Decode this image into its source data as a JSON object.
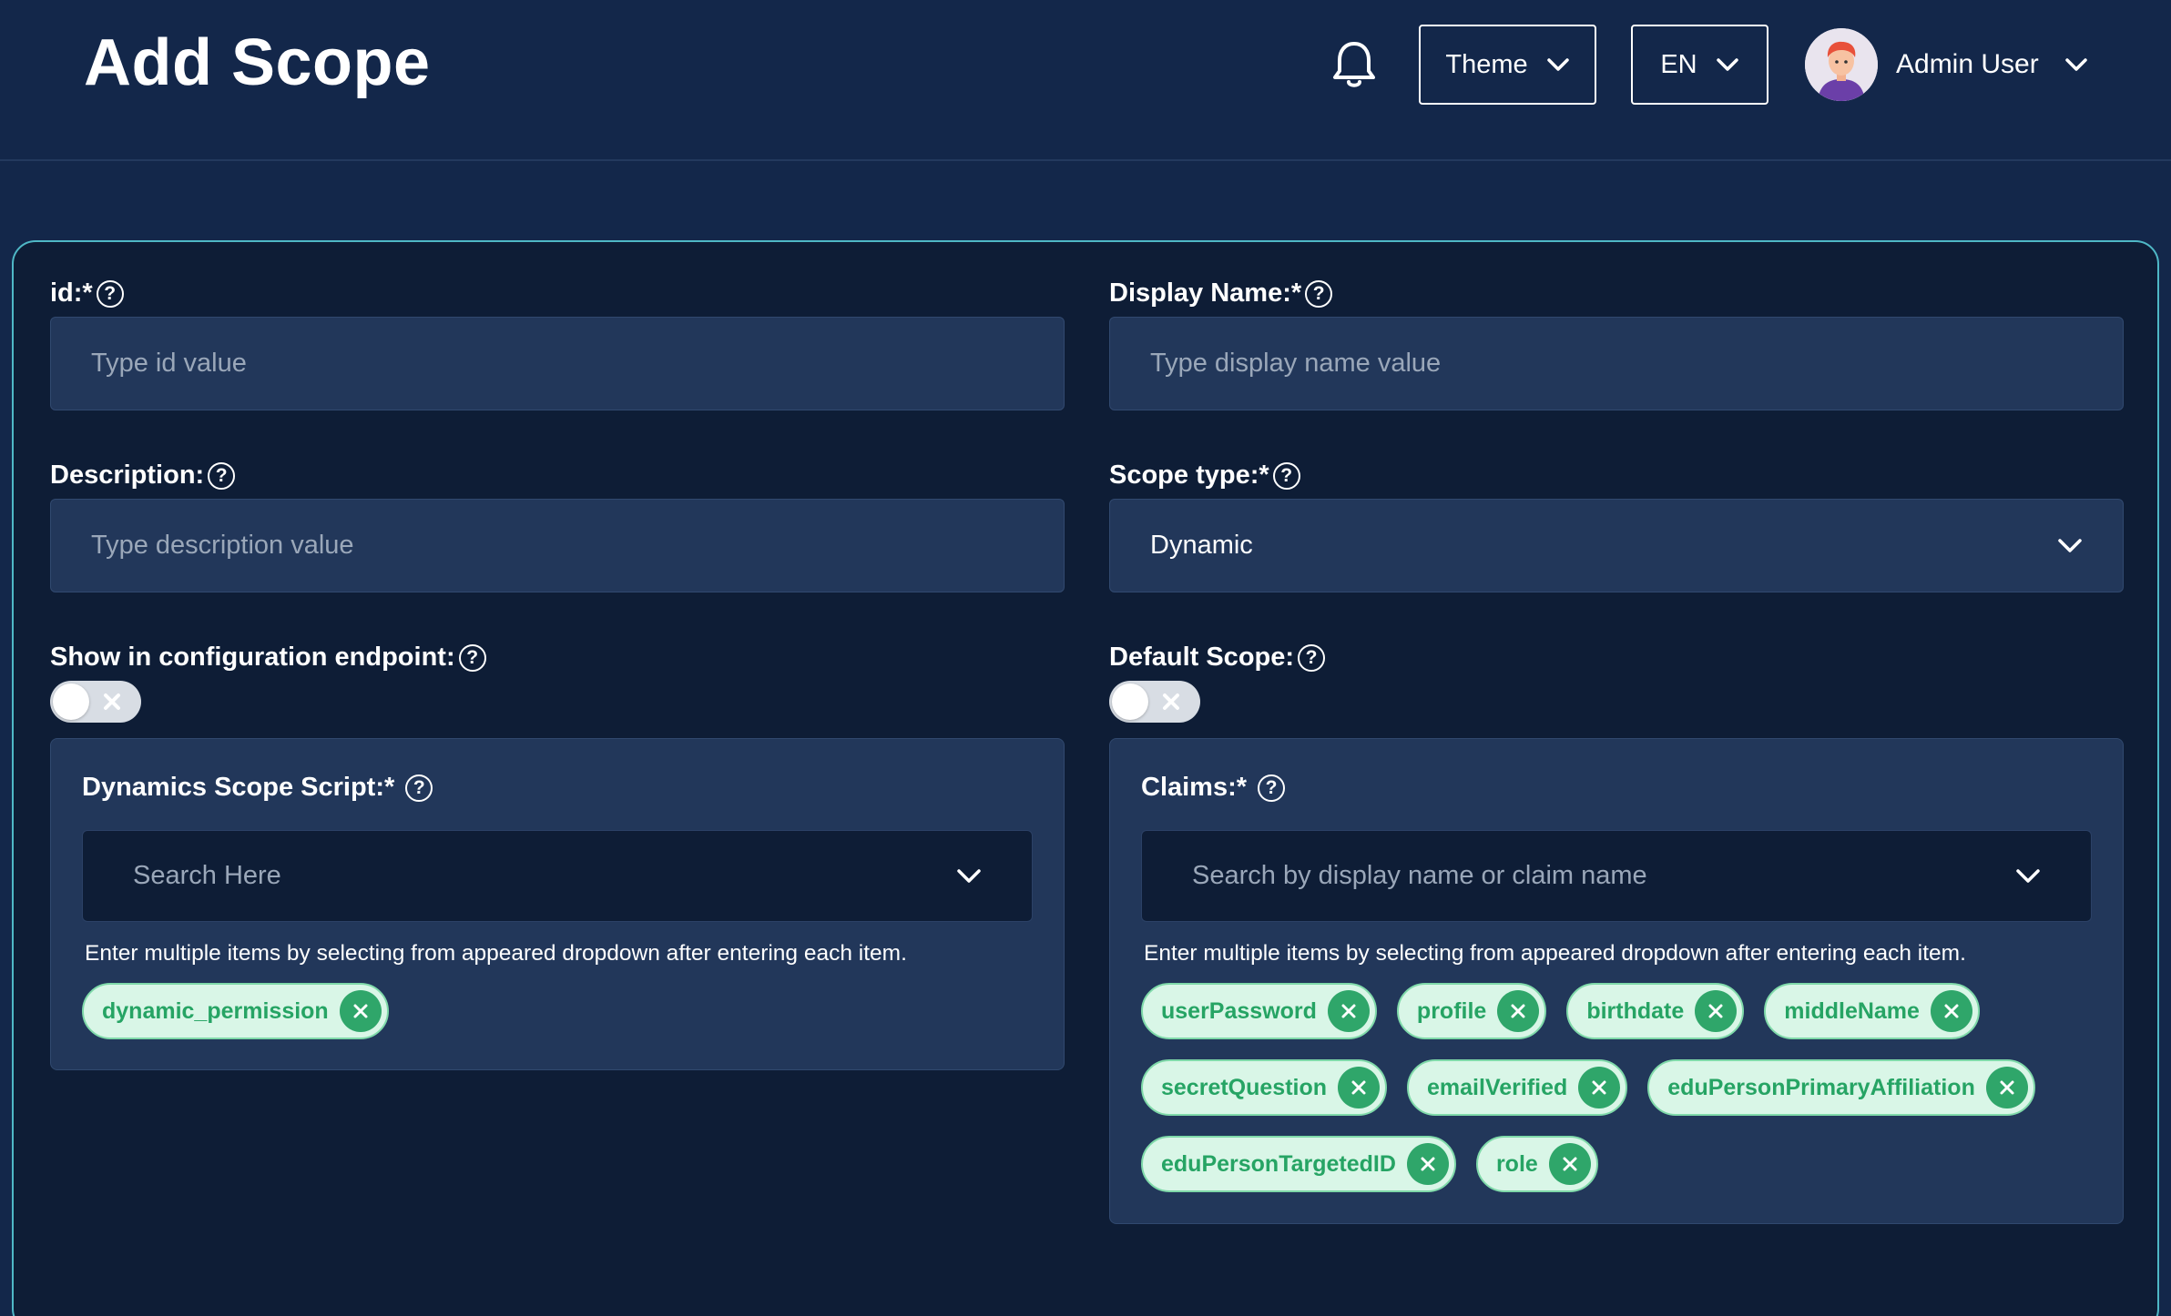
{
  "header": {
    "title": "Add Scope",
    "theme_label": "Theme",
    "language_label": "EN",
    "user_name": "Admin User"
  },
  "form": {
    "id": {
      "label": "id:*",
      "placeholder": "Type id value"
    },
    "display_name": {
      "label": "Display Name:*",
      "placeholder": "Type display name value"
    },
    "description": {
      "label": "Description:",
      "placeholder": "Type description value"
    },
    "scope_type": {
      "label": "Scope type:*",
      "value": "Dynamic"
    },
    "show_in_config": {
      "label": "Show in configuration endpoint:",
      "enabled": false
    },
    "default_scope": {
      "label": "Default Scope:",
      "enabled": false
    },
    "dynamic_script": {
      "label": "Dynamics Scope Script:*",
      "placeholder": "Search Here",
      "hint": "Enter multiple items by selecting from appeared dropdown after entering each item.",
      "selected": [
        "dynamic_permission"
      ]
    },
    "claims": {
      "label": "Claims:*",
      "placeholder": "Search by display name or claim name",
      "hint": "Enter multiple items by selecting from appeared dropdown after entering each item.",
      "selected": [
        "userPassword",
        "profile",
        "birthdate",
        "middleName",
        "secretQuestion",
        "emailVerified",
        "eduPersonPrimaryAffiliation",
        "eduPersonTargetedID",
        "role"
      ]
    }
  },
  "colors": {
    "background": "#13274a",
    "card": "#0e1d36",
    "card_border": "#4fb8c6",
    "input": "#22375a",
    "chip_bg": "#d9f6e7",
    "chip_text": "#26a464"
  }
}
